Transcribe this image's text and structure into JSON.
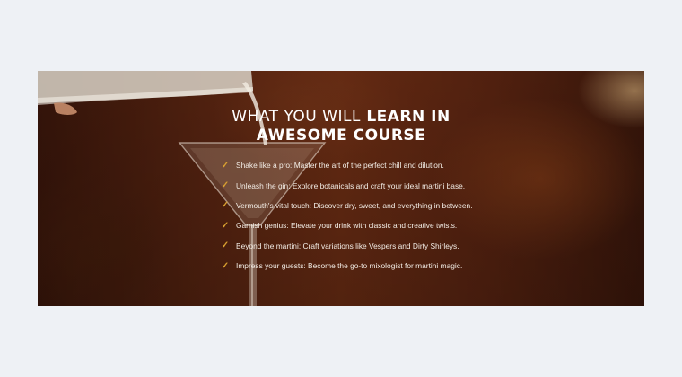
{
  "section": {
    "title_line1_light": "WHAT YOU WILL",
    "title_line1_bold": "LEARN IN",
    "title_line2": "AWESOME COURSE"
  },
  "features": [
    {
      "icon": "check-icon",
      "text": "Shake like a pro: Master the art of the perfect chill and dilution."
    },
    {
      "icon": "check-icon",
      "text": "Unleash the gin: Explore botanicals and craft your ideal martini base."
    },
    {
      "icon": "check-icon",
      "text": "Vermouth's vital touch: Discover dry, sweet, and everything in between."
    },
    {
      "icon": "check-icon",
      "text": "Garnish genius: Elevate your drink with classic and creative twists."
    },
    {
      "icon": "check-icon",
      "text": "Beyond the martini: Craft variations like Vespers and Dirty Shirleys."
    },
    {
      "icon": "check-icon",
      "text": "Impress your guests: Become the go-to mixologist for martini magic."
    }
  ],
  "colors": {
    "page_background": "#eef1f5",
    "check": "#d8a030",
    "text": "#ffffff"
  }
}
